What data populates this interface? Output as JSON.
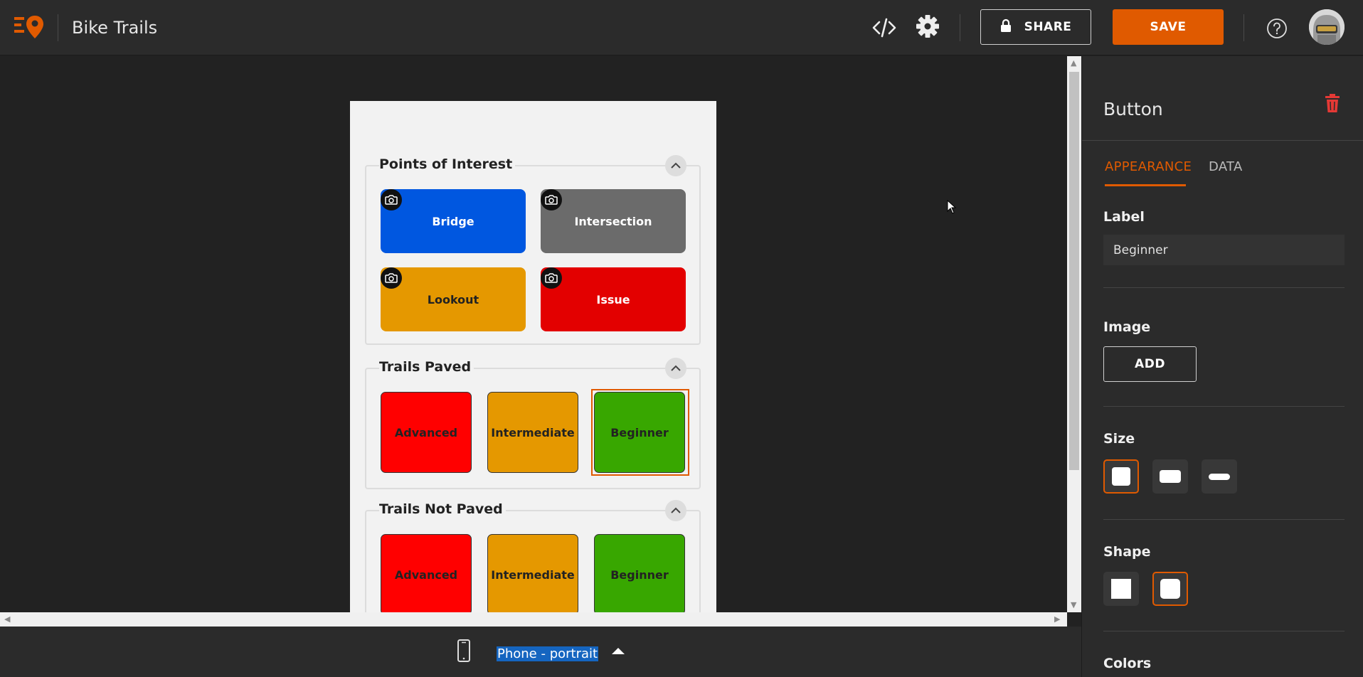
{
  "app": {
    "title": "Bike Trails"
  },
  "toolbar": {
    "share_label": "SHARE",
    "save_label": "SAVE"
  },
  "preview": {
    "sections": [
      {
        "title": "Points of Interest",
        "buttons": [
          "Bridge",
          "Intersection",
          "Lookout",
          "Issue"
        ]
      },
      {
        "title": "Trails Paved",
        "buttons": [
          "Advanced",
          "Intermediate",
          "Beginner"
        ]
      },
      {
        "title": "Trails Not Paved",
        "buttons": [
          "Advanced",
          "Intermediate",
          "Beginner"
        ]
      }
    ]
  },
  "bottom": {
    "device": "Phone - portrait"
  },
  "panel": {
    "title": "Button",
    "tabs": [
      "APPEARANCE",
      "DATA"
    ],
    "label_heading": "Label",
    "label_value": "Beginner",
    "image_heading": "Image",
    "add_label": "ADD",
    "size_heading": "Size",
    "shape_heading": "Shape",
    "colors_heading": "Colors"
  },
  "colors": {
    "accent": "#e05a00",
    "bridge": "#0057e0",
    "intersection": "#6b6b6b",
    "lookout": "#e59800",
    "issue": "#e30000",
    "advanced": "#ff0000",
    "intermediate": "#e59800",
    "beginner": "#38a700"
  }
}
